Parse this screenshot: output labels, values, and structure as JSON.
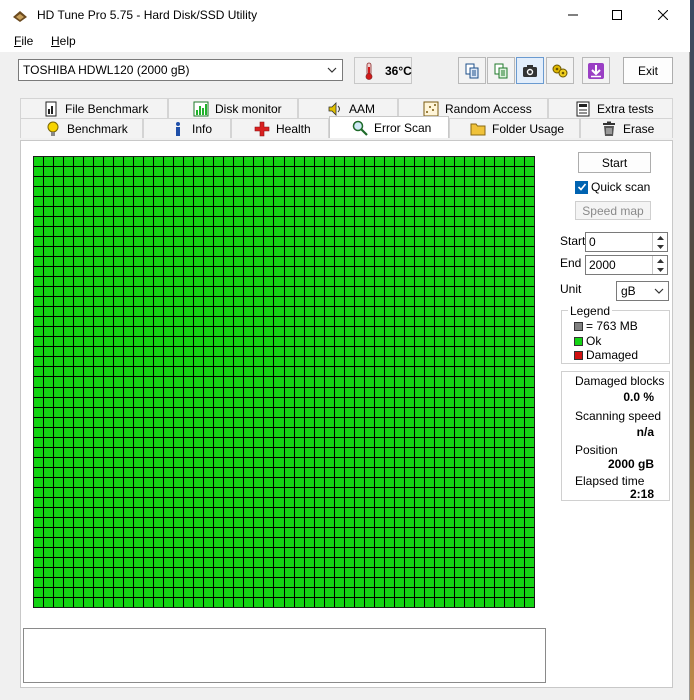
{
  "window": {
    "title": "HD Tune Pro 5.75 - Hard Disk/SSD Utility"
  },
  "menu": {
    "file_ul": "F",
    "file_rest": "ile",
    "help_ul": "H",
    "help_rest": "elp"
  },
  "toolbar": {
    "drive": "TOSHIBA HDWL120 (2000 gB)",
    "temperature": "36°C",
    "exit_label": "Exit",
    "tool_icons": [
      "copy-icon",
      "copy-all-icon",
      "screenshot-camera-icon",
      "options-icon",
      "save-arrow-icon"
    ]
  },
  "tabs_top": [
    {
      "label": "File Benchmark",
      "icon": "file-benchmark-icon"
    },
    {
      "label": "Disk monitor",
      "icon": "disk-monitor-icon"
    },
    {
      "label": "AAM",
      "icon": "speaker-icon"
    },
    {
      "label": "Random Access",
      "icon": "random-access-icon"
    },
    {
      "label": "Extra tests",
      "icon": "extra-tests-icon"
    }
  ],
  "tabs_bottom": [
    {
      "label": "Benchmark",
      "icon": "lightbulb-icon"
    },
    {
      "label": "Info",
      "icon": "info-icon"
    },
    {
      "label": "Health",
      "icon": "health-cross-icon"
    },
    {
      "label": "Error Scan",
      "icon": "magnifier-icon",
      "active": true
    },
    {
      "label": "Folder Usage",
      "icon": "folder-icon"
    },
    {
      "label": "Erase",
      "icon": "trash-icon"
    }
  ],
  "error_scan": {
    "start_label": "Start",
    "quick_scan_label": "Quick scan",
    "quick_scan_checked": true,
    "speed_map_label": "Speed map",
    "start_field_label": "Start",
    "start_value": "0",
    "end_field_label": "End",
    "end_value": "2000",
    "unit_label": "Unit",
    "unit_value": "gB",
    "grid": {
      "columns": 50,
      "rows": 45,
      "status": "ok"
    },
    "legend": {
      "title": "Legend",
      "items": [
        {
          "label": "= 763 MB",
          "color": "#808080"
        },
        {
          "label": "Ok",
          "color": "#14d414"
        },
        {
          "label": "Damaged",
          "color": "#d01010"
        }
      ]
    },
    "stats": {
      "damaged_blocks_label": "Damaged blocks",
      "damaged_blocks_value": "0.0 %",
      "scanning_speed_label": "Scanning speed",
      "scanning_speed_value": "n/a",
      "position_label": "Position",
      "position_value": "2000 gB",
      "elapsed_label": "Elapsed time",
      "elapsed_value": "2:18"
    }
  }
}
